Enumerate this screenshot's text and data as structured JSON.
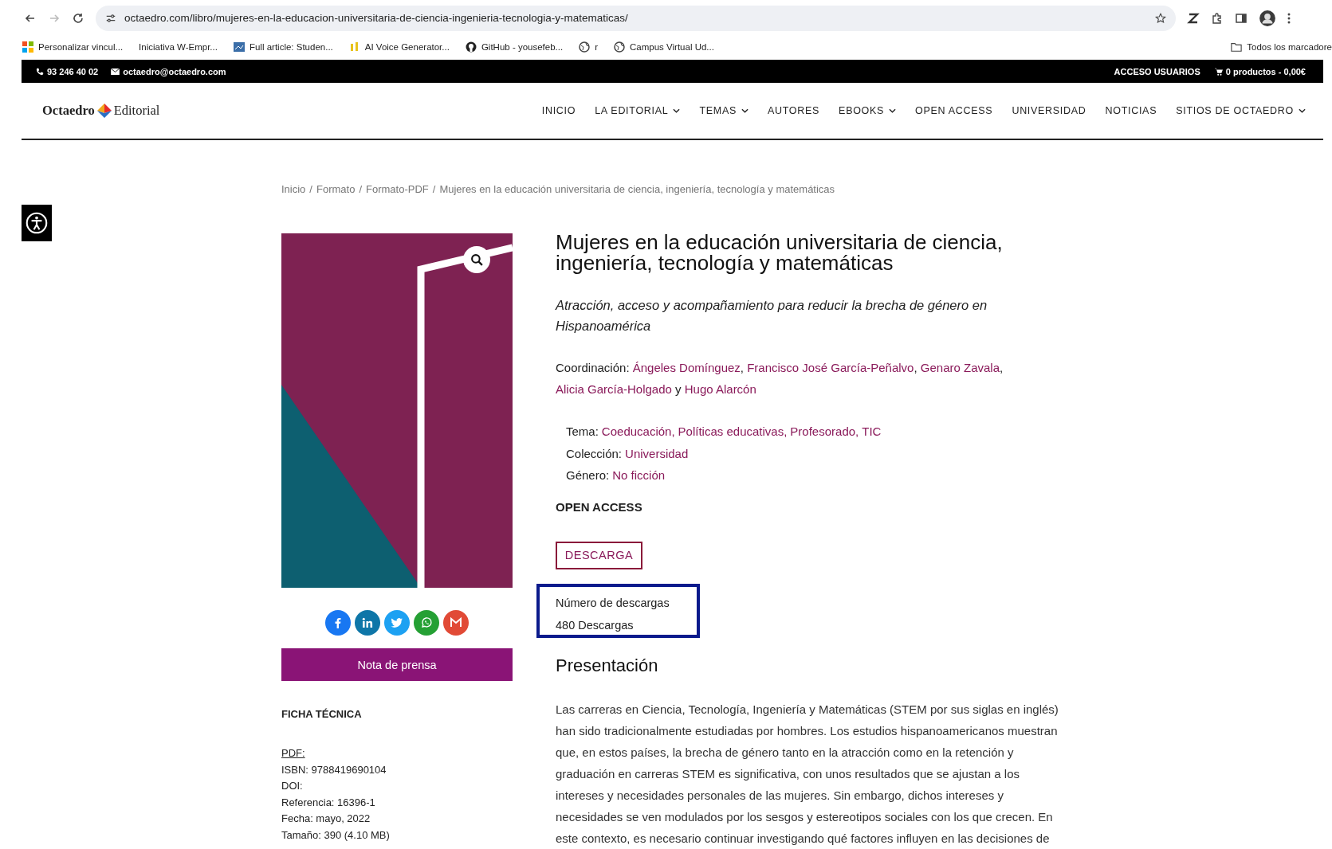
{
  "browser": {
    "url": "octaedro.com/libro/mujeres-en-la-educacion-universitaria-de-ciencia-ingenieria-tecnologia-y-matematicas/",
    "bookmarks": [
      {
        "label": "Personalizar vincul...",
        "kind": "grid"
      },
      {
        "label": "Iniciativa W-Empr...",
        "kind": "none"
      },
      {
        "label": "Full article: Studen...",
        "kind": "doc"
      },
      {
        "label": "AI Voice Generator...",
        "kind": "bars"
      },
      {
        "label": "GitHub - yousefeb...",
        "kind": "github"
      },
      {
        "label": "r",
        "kind": "globe"
      },
      {
        "label": "Campus Virtual Ud...",
        "kind": "globe"
      }
    ],
    "folder": "Todos los marcadore"
  },
  "topbar": {
    "phone": "93 246 40 02",
    "email": "octaedro@octaedro.com",
    "login": "ACCESO USUARIOS",
    "cart": "0 productos - 0,00€"
  },
  "nav": {
    "logo": {
      "name": "Octaedro",
      "suffix": "Editorial"
    },
    "items": [
      {
        "label": "INICIO",
        "dropdown": false
      },
      {
        "label": "LA EDITORIAL",
        "dropdown": true
      },
      {
        "label": "TEMAS",
        "dropdown": true
      },
      {
        "label": "AUTORES",
        "dropdown": false
      },
      {
        "label": "EBOOKS",
        "dropdown": true
      },
      {
        "label": "OPEN ACCESS",
        "dropdown": false
      },
      {
        "label": "UNIVERSIDAD",
        "dropdown": false
      },
      {
        "label": "NOTICIAS",
        "dropdown": false
      },
      {
        "label": "SITIOS DE OCTAEDRO",
        "dropdown": true
      }
    ]
  },
  "breadcrumb": {
    "separator": "/",
    "items": [
      "Inicio",
      "Formato",
      "Formato-PDF",
      "Mujeres en la educación universitaria de ciencia, ingeniería, tecnología y matemáticas"
    ]
  },
  "share": [
    {
      "kind": "facebook"
    },
    {
      "kind": "linkedin"
    },
    {
      "kind": "twitter"
    },
    {
      "kind": "whatsapp"
    },
    {
      "kind": "email"
    }
  ],
  "press_button": "Nota de prensa",
  "ficha": {
    "title": "FICHA TÉCNICA",
    "format": "PDF:",
    "lines": [
      "ISBN: 9788419690104",
      "DOI:",
      "Referencia: 16396-1",
      "Fecha: mayo, 2022",
      "Tamaño: 390 (4.10 MB)"
    ]
  },
  "product": {
    "title": "Mujeres en la educación universitaria de ciencia, ingeniería, tecnología y matemáticas",
    "subtitle": "Atracción, acceso y acompañamiento para reducir la brecha de género en Hispanoamérica",
    "coordination": {
      "label": "Coordinación:",
      "authors": [
        "Ángeles Domínguez",
        "Francisco José García-Peñalvo",
        "Genaro Zavala",
        "Alicia García-Holgado",
        "Hugo Alarcón"
      ],
      "separator": ",",
      "last_separator": "y"
    },
    "meta": [
      {
        "label": "Tema:",
        "values": [
          "Coeducación",
          "Políticas educativas",
          "Profesorado",
          "TIC"
        ],
        "separator": ","
      },
      {
        "label": "Colección:",
        "values": [
          "Universidad"
        ]
      },
      {
        "label": "Género:",
        "values": [
          "No ficción"
        ]
      }
    ],
    "access": "OPEN ACCESS",
    "download_button": "DESCARGA",
    "downloads": {
      "label": "Número de descargas",
      "count": "480 Descargas"
    },
    "heading": "Presentación",
    "paragraph": "Las carreras en Ciencia, Tecnología, Ingeniería y Matemáticas (STEM por sus siglas en inglés) han sido tradicionalmente estudiadas por hombres. Los estudios hispanoamericanos muestran que, en estos países, la brecha de género tanto en la atracción como en la retención y graduación en carreras STEM es significativa, con unos resultados que se ajustan a los intereses y necesidades personales de las mujeres. Sin embargo, dichos intereses y necesidades se ven modulados por los sesgos y estereotipos sociales con los que crecen. En este contexto, es necesario continuar investigando qué factores influyen en las decisiones de"
  }
}
